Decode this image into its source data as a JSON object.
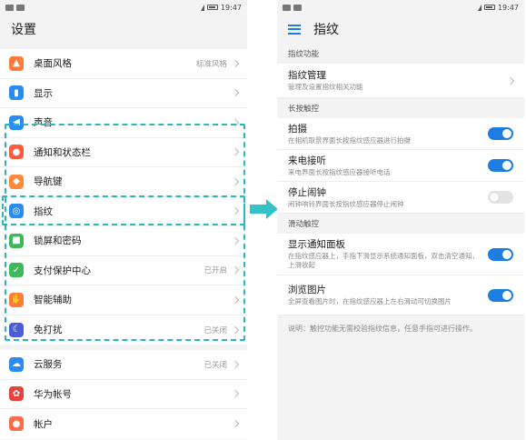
{
  "status": {
    "time": "19:47"
  },
  "left": {
    "title": "设置",
    "groups": [
      [
        {
          "name": "theme",
          "icon": "theme-icon",
          "color": "#ff7b3a",
          "glyph": "▲",
          "label": "桌面风格",
          "value": "标准风格"
        },
        {
          "name": "display",
          "icon": "display-icon",
          "color": "#2a8cf0",
          "glyph": "▮",
          "label": "显示",
          "value": ""
        },
        {
          "name": "sound",
          "icon": "sound-icon",
          "color": "#2a8cf0",
          "glyph": "◀",
          "label": "声音",
          "value": ""
        },
        {
          "name": "notification",
          "icon": "notification-bell-icon",
          "color": "#ff5a3c",
          "glyph": "●",
          "label": "通知和状态栏",
          "value": ""
        },
        {
          "name": "navigation-key",
          "icon": "navigation-key-icon",
          "color": "#ff8a3d",
          "glyph": "◆",
          "label": "导航键",
          "value": ""
        },
        {
          "name": "fingerprint",
          "icon": "fingerprint-icon",
          "color": "#2a8cf0",
          "glyph": "◎",
          "label": "指纹",
          "value": ""
        },
        {
          "name": "lock-screen",
          "icon": "lock-icon",
          "color": "#3fb85a",
          "glyph": "■",
          "label": "锁屏和密码",
          "value": ""
        },
        {
          "name": "payment-protection",
          "icon": "shield-icon",
          "color": "#3fb85a",
          "glyph": "✓",
          "label": "支付保护中心",
          "value": "已开启"
        },
        {
          "name": "smart-assist",
          "icon": "hand-icon",
          "color": "#ff7b3a",
          "glyph": "✋",
          "label": "智能辅助",
          "value": ""
        },
        {
          "name": "do-not-disturb",
          "icon": "moon-icon",
          "color": "#4a5cd6",
          "glyph": "☾",
          "label": "免打扰",
          "value": "已关闭"
        }
      ],
      [
        {
          "name": "cloud-service",
          "icon": "cloud-icon",
          "color": "#2a8cf0",
          "glyph": "☁",
          "label": "云服务",
          "value": "已关闭"
        },
        {
          "name": "huawei-account",
          "icon": "huawei-logo-icon",
          "color": "#e8403a",
          "glyph": "✿",
          "label": "华为帐号",
          "value": ""
        },
        {
          "name": "account",
          "icon": "person-icon",
          "color": "#ff6a4a",
          "glyph": "●",
          "label": "帐户",
          "value": ""
        }
      ]
    ]
  },
  "right": {
    "title": "指纹",
    "sections": [
      {
        "header": "指纹功能",
        "items": [
          {
            "name": "fingerprint-management",
            "title": "指纹管理",
            "sub": "管理及设置指纹相关功能",
            "control": "chevron"
          }
        ]
      },
      {
        "header": "长按触控",
        "items": [
          {
            "name": "take-photo",
            "title": "拍摄",
            "sub": "在相机取景界面长按指纹感应器进行拍摄",
            "control": "toggle",
            "on": true
          },
          {
            "name": "answer-call",
            "title": "来电接听",
            "sub": "来电界面长按指纹感应器接听电话",
            "control": "toggle",
            "on": true
          },
          {
            "name": "stop-alarm",
            "title": "停止闹钟",
            "sub": "闹钟响铃界面长按指纹感应器停止闹钟",
            "control": "toggle",
            "on": false
          }
        ]
      },
      {
        "header": "滑动触控",
        "items": [
          {
            "name": "show-notification-panel",
            "title": "显示通知面板",
            "sub": "在指纹感应器上，手指下滑显示系统通知面板，双击清空通知，上滑收起",
            "control": "toggle",
            "on": true
          },
          {
            "name": "browse-pictures",
            "title": "浏览图片",
            "sub": "全屏查看图片时，在指纹感应器上左右滑动可切换图片",
            "control": "toggle",
            "on": true
          }
        ]
      }
    ],
    "note": "说明：触控功能无需校验指纹信息，任意手指可进行操作。"
  }
}
